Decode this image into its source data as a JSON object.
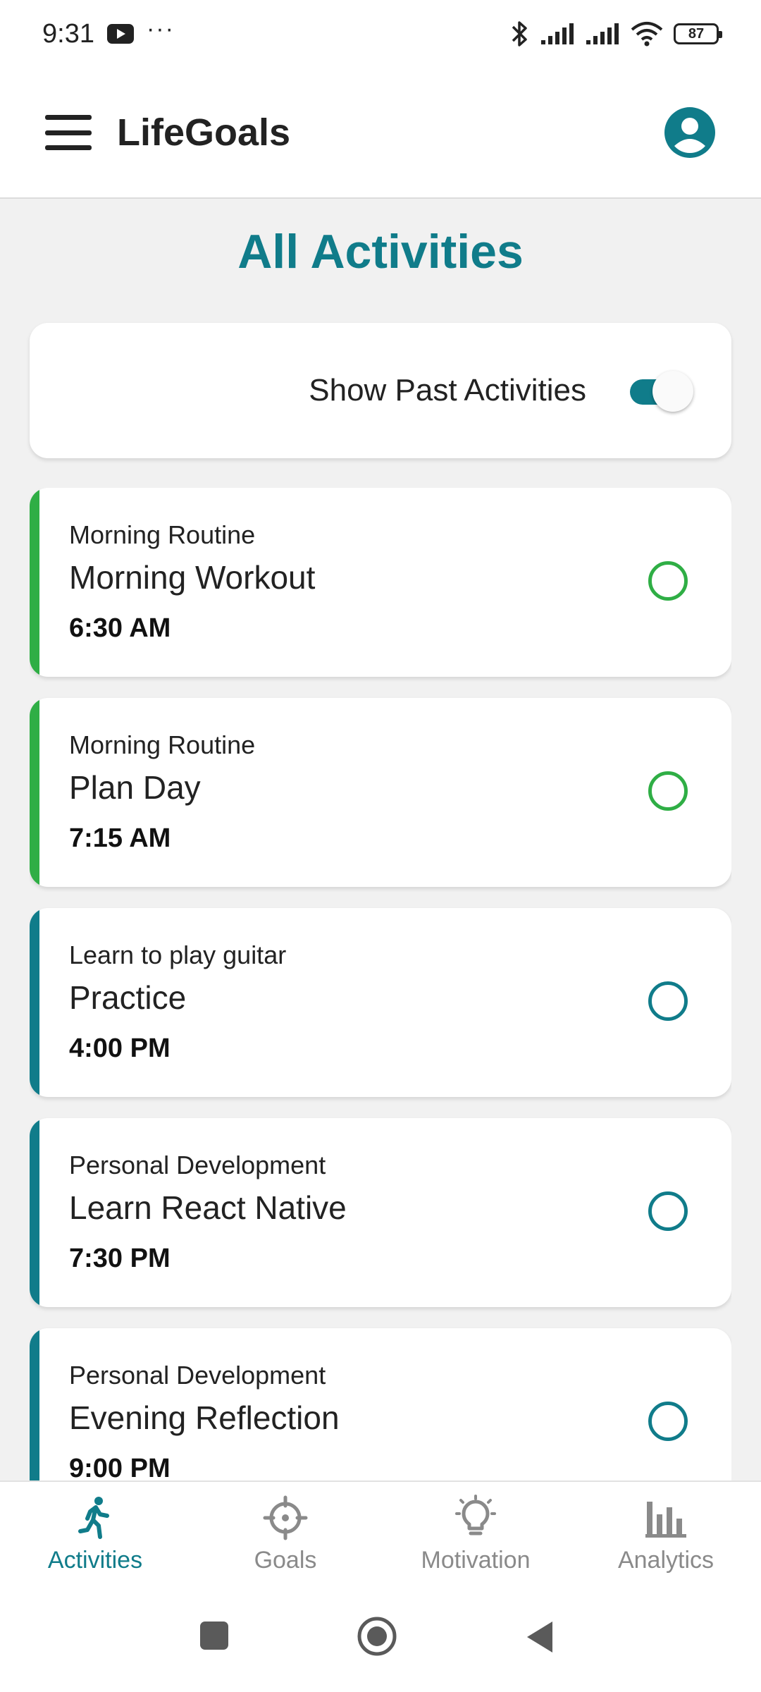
{
  "status_bar": {
    "time": "9:31",
    "battery": "87",
    "icons": [
      "youtube-icon",
      "more-dots-icon",
      "bluetooth-icon",
      "signal-icon",
      "signal-icon",
      "wifi-icon",
      "battery-icon"
    ]
  },
  "app_bar": {
    "title": "LifeGoals",
    "menu_icon": "hamburger-menu-icon",
    "profile_icon": "account-circle-icon"
  },
  "page": {
    "title": "All Activities"
  },
  "filter": {
    "label": "Show Past Activities",
    "enabled": true
  },
  "activities": [
    {
      "category": "Morning Routine",
      "name": "Morning Workout",
      "time": "6:30 AM",
      "color": "#2fae45"
    },
    {
      "category": "Morning Routine",
      "name": "Plan Day",
      "time": "7:15 AM",
      "color": "#2fae45"
    },
    {
      "category": "Learn to play guitar",
      "name": "Practice",
      "time": "4:00 PM",
      "color": "#107c8a"
    },
    {
      "category": "Personal Development",
      "name": "Learn React Native",
      "time": "7:30 PM",
      "color": "#107c8a"
    },
    {
      "category": "Personal Development",
      "name": "Evening Reflection",
      "time": "9:00 PM",
      "color": "#107c8a"
    }
  ],
  "bottom_nav": {
    "items": [
      {
        "label": "Activities",
        "icon": "running-icon",
        "active": true
      },
      {
        "label": "Goals",
        "icon": "target-icon",
        "active": false
      },
      {
        "label": "Motivation",
        "icon": "lightbulb-icon",
        "active": false
      },
      {
        "label": "Analytics",
        "icon": "bar-chart-icon",
        "active": false
      }
    ]
  },
  "colors": {
    "accent": "#107c8a",
    "green": "#2fae45",
    "inactive": "#8a8a8a"
  }
}
